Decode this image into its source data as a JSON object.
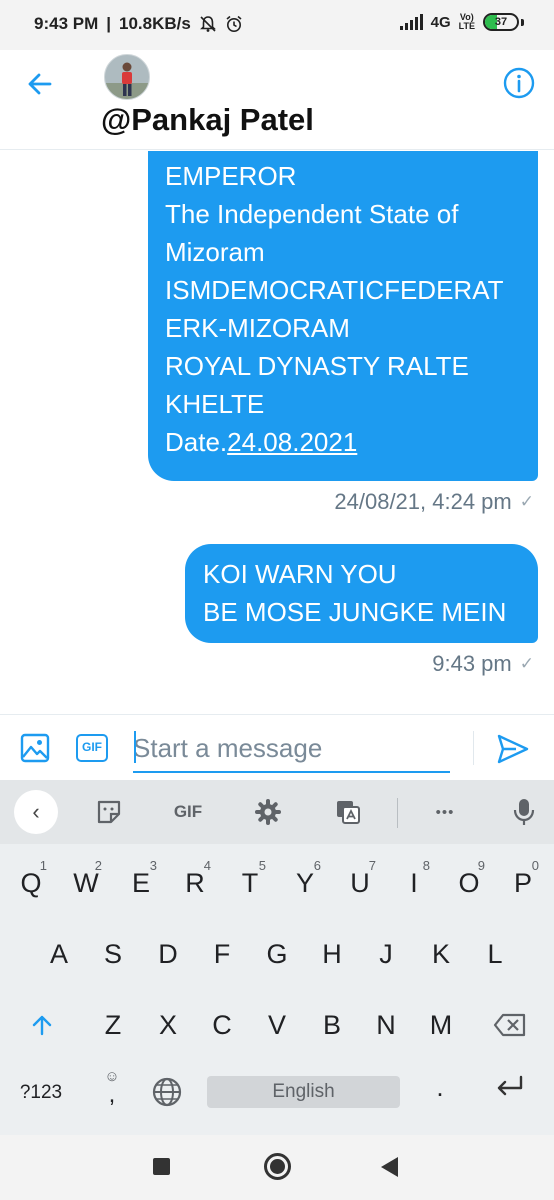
{
  "status_bar": {
    "time": "9:43 PM",
    "speed": "10.8KB/s",
    "network": "4G",
    "volte_top": "Vo)",
    "volte_bottom": "LTE",
    "battery": "37"
  },
  "header": {
    "handle": "@Pankaj Patel",
    "back_icon": "arrow-left-icon",
    "info_icon": "info-icon"
  },
  "messages": [
    {
      "lines": [
        "EMPEROR",
        "The Independent State of",
        "Mizoram",
        "ISMDEMOCRATICFEDERAT",
        "ERK-MIZORAM",
        "ROYAL DYNASTY RALTE",
        "KHELTE"
      ],
      "date_prefix": "Date.",
      "date_link": "24.08.2021",
      "timestamp": "24/08/21, 4:24 pm"
    },
    {
      "lines": [
        "KOI WARN YOU",
        "BE MOSE JUNGKE MEIN"
      ],
      "timestamp": "9:43 pm"
    }
  ],
  "composer": {
    "placeholder": "Start a message",
    "value": "",
    "gif_label": "GIF"
  },
  "keyboard": {
    "toolbar_gif": "GIF",
    "toolbar_more": "•••",
    "row1": [
      {
        "k": "Q",
        "n": "1"
      },
      {
        "k": "W",
        "n": "2"
      },
      {
        "k": "E",
        "n": "3"
      },
      {
        "k": "R",
        "n": "4"
      },
      {
        "k": "T",
        "n": "5"
      },
      {
        "k": "Y",
        "n": "6"
      },
      {
        "k": "U",
        "n": "7"
      },
      {
        "k": "I",
        "n": "8"
      },
      {
        "k": "O",
        "n": "9"
      },
      {
        "k": "P",
        "n": "0"
      }
    ],
    "row2": [
      "A",
      "S",
      "D",
      "F",
      "G",
      "H",
      "J",
      "K",
      "L"
    ],
    "row3": [
      "Z",
      "X",
      "C",
      "V",
      "B",
      "N",
      "M"
    ],
    "symbols_key": "?123",
    "emoji_key": ",",
    "space_label": "English",
    "period_key": ".",
    "enter_key": "↵"
  }
}
